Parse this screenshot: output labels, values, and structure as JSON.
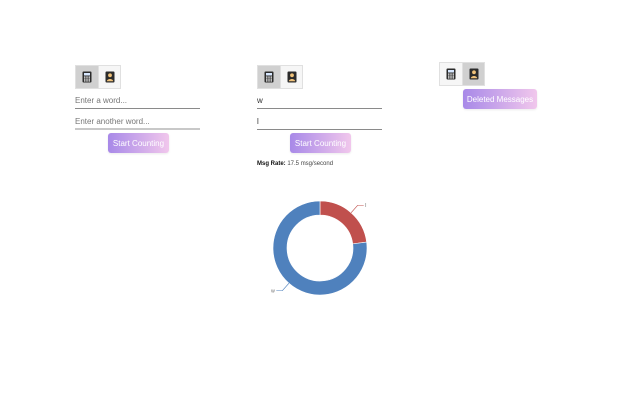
{
  "panel1": {
    "toggle": {
      "icons": [
        "calculator-icon",
        "contact-card-icon"
      ],
      "active": 0
    },
    "input1": {
      "placeholder": "Enter a word...",
      "value": ""
    },
    "input2": {
      "placeholder": "Enter another word...",
      "value": ""
    },
    "button_label": "Start Counting"
  },
  "panel2": {
    "toggle": {
      "icons": [
        "calculator-icon",
        "contact-card-icon"
      ],
      "active": 0
    },
    "input1": {
      "value": "w"
    },
    "input2": {
      "value": "l"
    },
    "button_label": "Start Counting",
    "rate_label": "Msg Rate:",
    "rate_value": "17.5 msg/second"
  },
  "panel3": {
    "toggle": {
      "icons": [
        "calculator-icon",
        "contact-card-icon"
      ],
      "active": 1
    },
    "button_label": "Deleted Messages"
  },
  "colors": {
    "series_blue": "#4f81bd",
    "series_red": "#c0504d",
    "button_gradient_start": "#a889e8",
    "button_gradient_end": "#f1c7ec"
  },
  "chart_data": {
    "type": "pie",
    "donut": true,
    "series": [
      {
        "name": "w",
        "value": 77,
        "color": "#4f81bd"
      },
      {
        "name": "l",
        "value": 23,
        "color": "#c0504d"
      }
    ],
    "slice_labels": [
      "w",
      "l"
    ],
    "title": ""
  }
}
